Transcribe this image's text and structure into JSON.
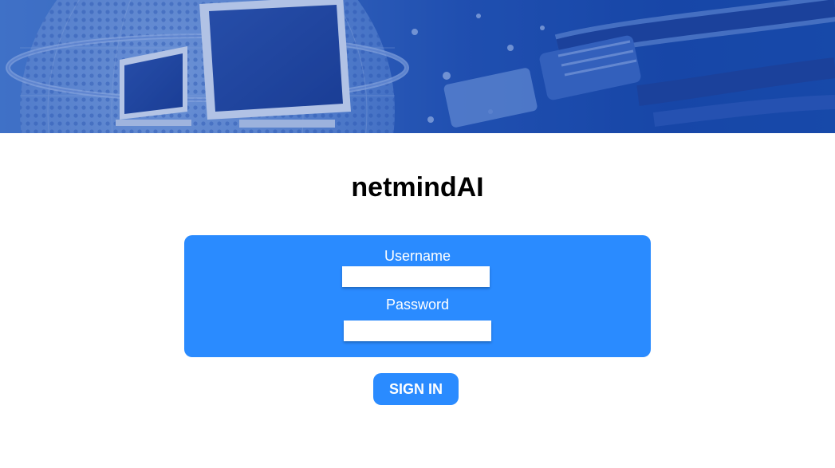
{
  "app": {
    "title": "netmindAI"
  },
  "login_form": {
    "username_label": "Username",
    "username_value": "",
    "password_label": "Password",
    "password_value": "",
    "submit_label": "SIGN IN"
  },
  "colors": {
    "panel": "#2a8bff",
    "button": "#2a8bff",
    "hero": "#1746a6",
    "title_text": "#000000"
  }
}
